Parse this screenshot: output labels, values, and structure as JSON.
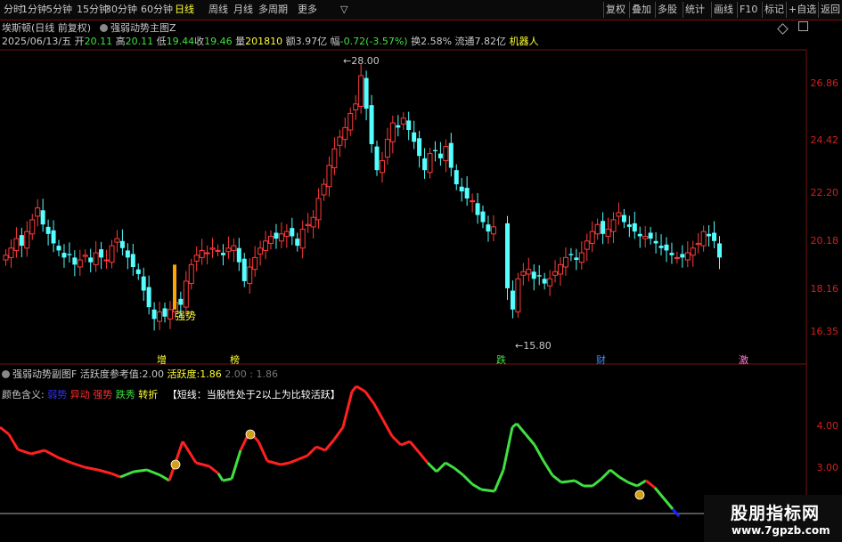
{
  "toolbar": {
    "periods": [
      "分时",
      "1分钟",
      "5分钟",
      "15分钟",
      "30分钟",
      "60分钟",
      "日线",
      "周线",
      "月线",
      "多周期",
      "更多"
    ],
    "active_period": "日线",
    "more_arrow": "▽",
    "right_buttons": [
      "复权",
      "叠加",
      "多股",
      "统计",
      "画线",
      "F10",
      "标记",
      "+自选",
      "返回"
    ]
  },
  "stock": {
    "name_line": "埃斯顿(日线 前复权)",
    "indicator_name": "强弱动势主图Z",
    "date": "2025/06/13/五",
    "open_label": "开",
    "open": "20.11",
    "high_label": "高",
    "high": "20.11",
    "low_label": "低",
    "low": "19.44",
    "close_label": "收",
    "close": "19.46",
    "volume_label": "量",
    "volume": "201810",
    "amount_label": "额",
    "amount": "3.97亿",
    "change_label": "幅",
    "change": "-0.72(-3.57%)",
    "turnover_label": "换",
    "turnover": "2.58%",
    "float_label": "流通",
    "float": "7.82亿",
    "concept": "机器人"
  },
  "main_axis": {
    "labels": [
      "26.86",
      "24.42",
      "22.20",
      "20.18",
      "18.16",
      "16.35"
    ]
  },
  "annotations": {
    "peak_price": "28.00",
    "low_price": "15.80",
    "strong_label": "强势",
    "bottom_marks": [
      "增",
      "榜",
      "跌",
      "财",
      "激"
    ]
  },
  "sub": {
    "indicator_name": "强弱动势副图F",
    "ref_label": "活跃度参考值:",
    "ref_value": "2.00",
    "active_label": "活跃度:",
    "active_value": "1.86",
    "extra_values": "2.00 : 1.86",
    "legend_title": "颜色含义:",
    "legend": [
      {
        "text": "弱势",
        "color": "#3030ff"
      },
      {
        "text": "异动",
        "color": "#ff3030"
      },
      {
        "text": "强势",
        "color": "#ff3030"
      },
      {
        "text": "跌秀",
        "color": "#40e040"
      },
      {
        "text": "转折",
        "color": "#ffff33"
      }
    ],
    "note": "【短线：当股性处于2以上为比较活跃】",
    "axis_labels": [
      "4.00",
      "3.00"
    ]
  },
  "colors": {
    "up": "#ff3a3a",
    "down": "#54ffff",
    "axis": "#d02020",
    "green": "#40e040",
    "yellow": "#ffff33"
  },
  "watermark": {
    "title": "股朋指标网",
    "url": "www.7gpzb.com"
  }
}
